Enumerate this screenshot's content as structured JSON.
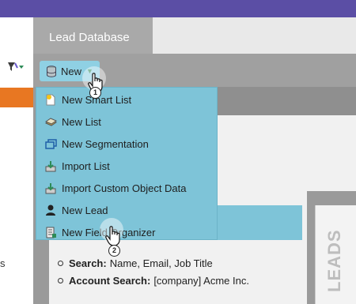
{
  "header": {
    "tab_active": "Lead Database"
  },
  "toolbar": {
    "new_label": "New",
    "filter_icon": "filter-icon"
  },
  "new_menu": {
    "items": [
      {
        "label": "New Smart List",
        "icon": "smart-list-icon"
      },
      {
        "label": "New List",
        "icon": "list-icon"
      },
      {
        "label": "New Segmentation",
        "icon": "segmentation-icon"
      },
      {
        "label": "Import List",
        "icon": "import-icon"
      },
      {
        "label": "Import Custom Object Data",
        "icon": "import-icon"
      },
      {
        "label": "New Lead",
        "icon": "person-icon"
      },
      {
        "label": "New Field Organizer",
        "icon": "field-organizer-icon"
      }
    ]
  },
  "search_help": {
    "items": [
      {
        "term": "Search:",
        "desc": "Name, Email, Job Title"
      },
      {
        "term": "Account Search:",
        "desc": "[company] Acme Inc."
      }
    ]
  },
  "side_panel": {
    "label": "LEADS"
  },
  "left_edge_text": "s",
  "step_badges": [
    "1",
    "2"
  ],
  "colors": {
    "top_bar": "#5b4ea5",
    "accent_orange": "#e87722",
    "menu_bg": "#7ec4d8"
  }
}
